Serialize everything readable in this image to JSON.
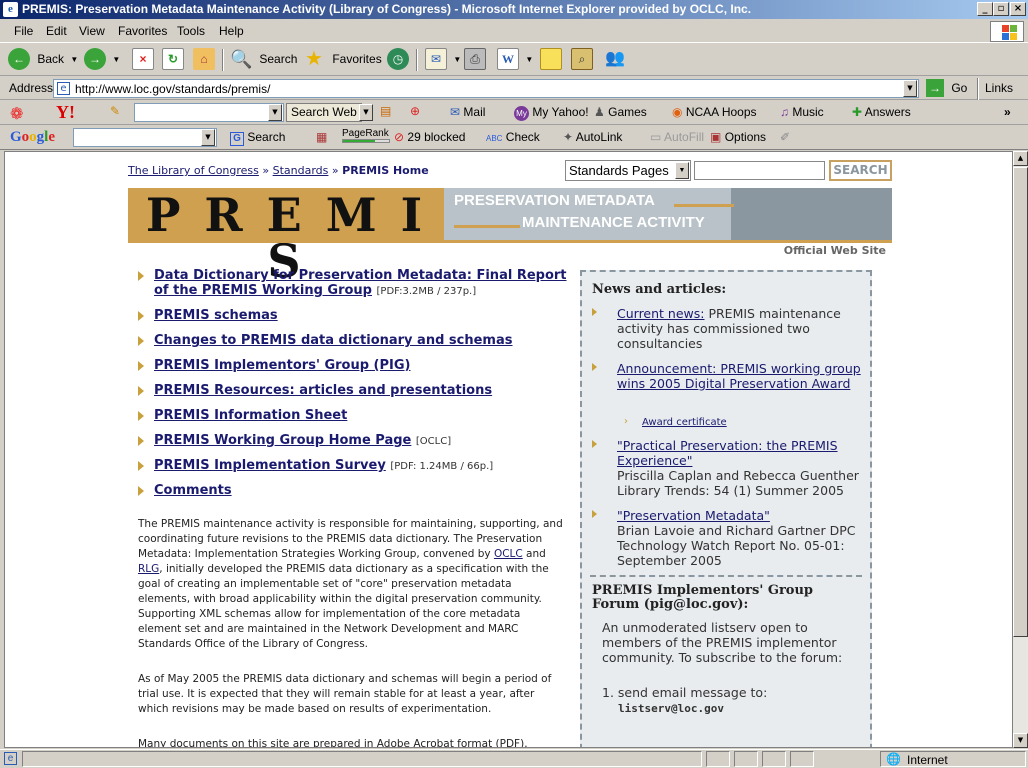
{
  "window": {
    "title": "PREMIS: Preservation Metadata Maintenance Activity (Library of Congress) - Microsoft Internet Explorer provided by OCLC, Inc."
  },
  "menu": [
    "File",
    "Edit",
    "View",
    "Favorites",
    "Tools",
    "Help"
  ],
  "toolbar": {
    "back": "Back",
    "search": "Search",
    "favorites": "Favorites"
  },
  "address": {
    "label": "Address",
    "url": "http://www.loc.gov/standards/premis/",
    "go": "Go",
    "links": "Links"
  },
  "yahoo": {
    "search_web": "Search Web",
    "mail": "Mail",
    "my_yahoo": "My Yahoo!",
    "games": "Games",
    "ncaa": "NCAA Hoops",
    "music": "Music",
    "answers": "Answers"
  },
  "google": {
    "search": "Search",
    "pagerank": "PageRank",
    "blocked": "29 blocked",
    "check": "Check",
    "autolink": "AutoLink",
    "autofill": "AutoFill",
    "options": "Options"
  },
  "page": {
    "breadcrumb": {
      "loc": "The Library of Congress",
      "sep1": "»",
      "standards": "Standards",
      "sep2": "»",
      "current": "PREMIS Home"
    },
    "search": {
      "select": "Standards Pages",
      "button": "SEARCH"
    },
    "banner": {
      "logo": "P R E M I S",
      "line1": "PRESERVATION METADATA",
      "line2": "MAINTENANCE ACTIVITY"
    },
    "official": "Official Web Site",
    "links": [
      {
        "text": "Data Dictionary for Preservation Metadata: Final Report of the PREMIS Working Group",
        "note": "[PDF:3.2MB / 237p.]"
      },
      {
        "text": "PREMIS schemas",
        "note": ""
      },
      {
        "text": "Changes to PREMIS data dictionary and schemas",
        "note": ""
      },
      {
        "text": "PREMIS Implementors' Group (PIG)",
        "note": ""
      },
      {
        "text": "PREMIS Resources: articles and presentations",
        "note": ""
      },
      {
        "text": "PREMIS Information Sheet",
        "note": ""
      },
      {
        "text": "PREMIS Working Group Home Page",
        "note": "[OCLC]"
      },
      {
        "text": "PREMIS Implementation Survey",
        "note": "[PDF: 1.24MB / 66p.]"
      },
      {
        "text": "Comments",
        "note": ""
      }
    ],
    "para1": {
      "a": "The PREMIS maintenance activity is responsible for maintaining, supporting, and coordinating future revisions to the PREMIS data dictionary. The Preservation Metadata: Implementation Strategies Working Group, convened by ",
      "oclc": "OCLC",
      "and": " and ",
      "rlg": "RLG",
      "b": ", initially developed the PREMIS data dictionary as a specification with the goal of creating an implementable set of \"core\" preservation metadata elements, with broad applicability within the digital preservation community. Supporting XML schemas allow for implementation of the core metadata element set and are maintained in the Network Development and MARC Standards Office of the Library of Congress."
    },
    "para2": "As of May 2005 the PREMIS data dictionary and schemas will begin a period of trial use. It is expected that they will remain stable for at least a year, after which revisions may be made based on results of experimentation.",
    "para3": "Many documents on this site are prepared in Adobe Acrobat format (PDF).",
    "sidebar": {
      "news_title": "News and articles:",
      "news": [
        {
          "link": "Current news:",
          "text": " PREMIS maintenance activity has commissioned two consultancies"
        },
        {
          "link": "Announcement: PREMIS working group wins 2005 Digital Preservation Award",
          "text": ""
        },
        {
          "link": "\"Practical Preservation: the PREMIS Experience\"",
          "text": "Priscilla Caplan and Rebecca Guenther Library Trends: 54 (1) Summer 2005"
        },
        {
          "link": "\"Preservation Metadata\"",
          "text": "Brian Lavoie and Richard Gartner DPC Technology Watch Report No. 05-01: September 2005"
        }
      ],
      "award_cert": "Award certificate",
      "pig_title": "PREMIS Implementors' Group Forum (pig@loc.gov):",
      "pig_text": "An unmoderated listserv open to members of the PREMIS implementor community. To subscribe to the forum:",
      "step1": "1. send email message to:",
      "step1_addr": "listserv@loc.gov"
    }
  },
  "status": {
    "zone": "Internet"
  }
}
